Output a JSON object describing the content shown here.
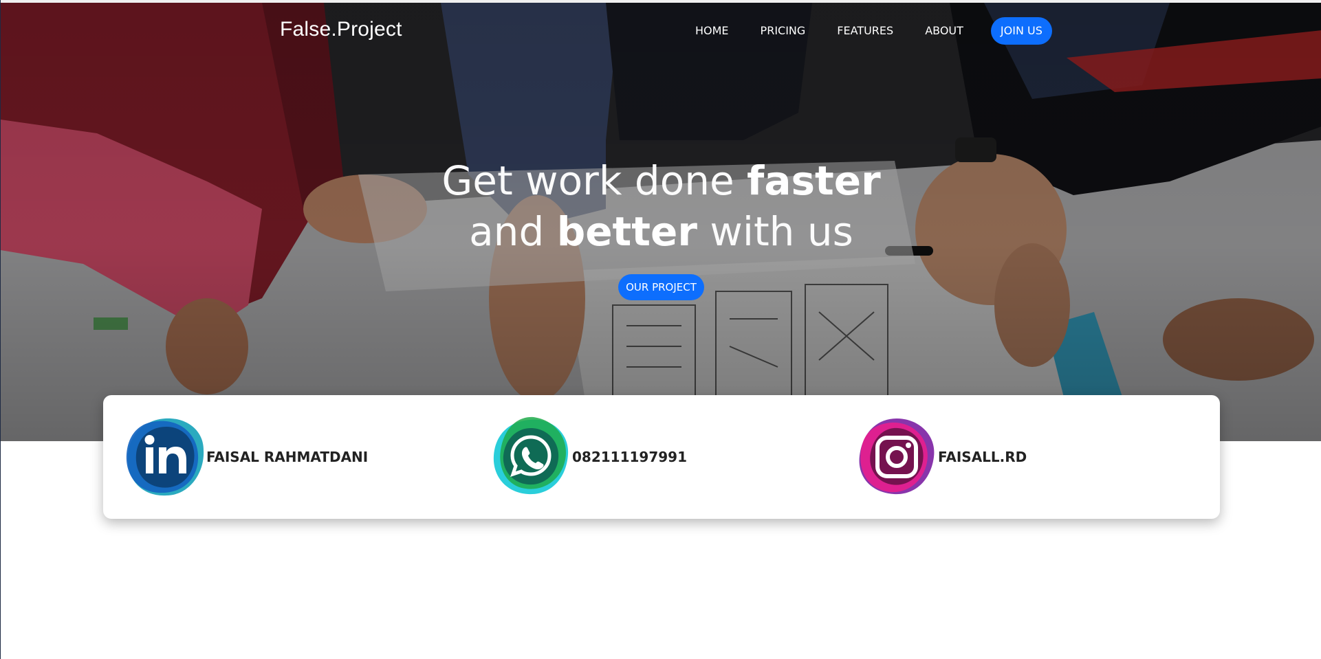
{
  "navbar": {
    "brand": "False.Project",
    "links": [
      "HOME",
      "PRICING",
      "FEATURES",
      "ABOUT"
    ],
    "join_label": "JOIN US",
    "accent_color": "#0d6efd"
  },
  "hero": {
    "line1_normal": "Get work done ",
    "line1_bold": "faster",
    "line2_normal_a": "and ",
    "line2_bold": "better",
    "line2_normal_b": " with us",
    "cta_label": "OUR PROJECT"
  },
  "contacts": [
    {
      "icon": "linkedin-icon",
      "label": "FAISAL RAHMATDANI"
    },
    {
      "icon": "whatsapp-icon",
      "label": "082111197991"
    },
    {
      "icon": "instagram-icon",
      "label": "FAISALL.RD"
    }
  ]
}
